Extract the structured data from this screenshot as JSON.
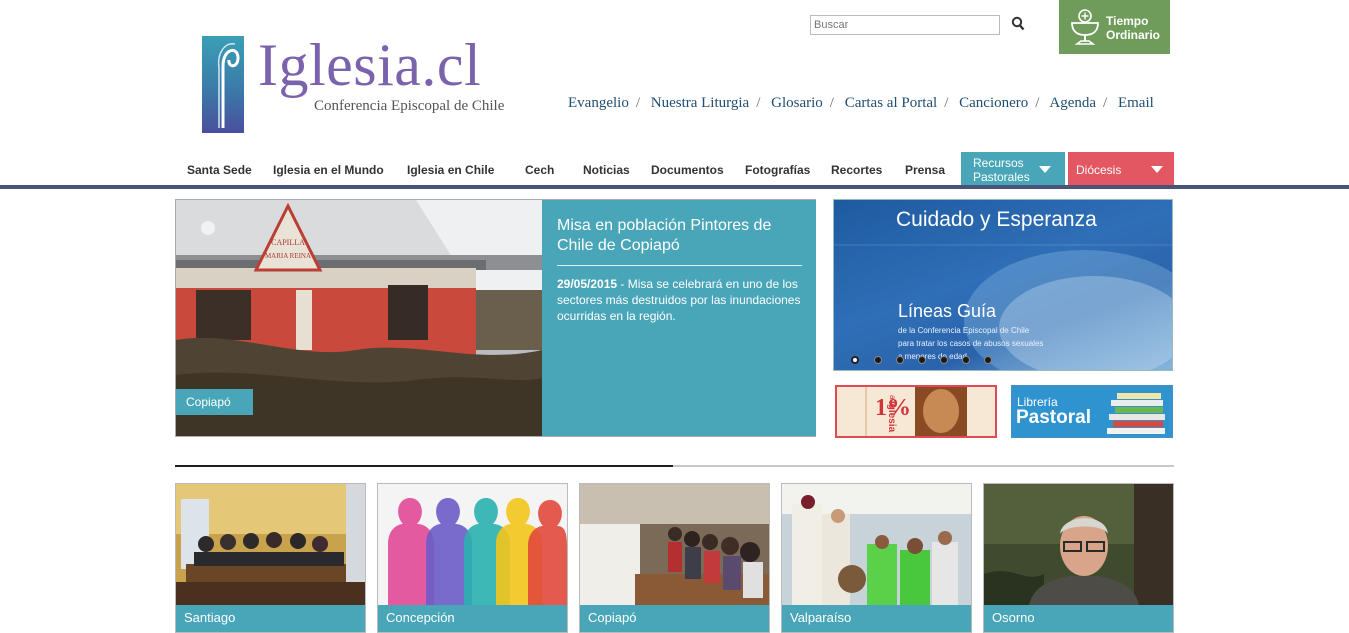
{
  "logo": {
    "word": "Iglesia.cl",
    "sub": "Conferencia Episcopal de Chile"
  },
  "search": {
    "placeholder": "Buscar"
  },
  "tiempo": {
    "line1": "Tiempo",
    "line2": "Ordinario"
  },
  "toplinks": [
    "Evangelio",
    "Nuestra Liturgia",
    "Glosario",
    "Cartas al Portal",
    "Cancionero",
    "Agenda",
    "Email"
  ],
  "nav": {
    "items": [
      "Santa Sede",
      "Iglesia en el Mundo",
      "Iglesia en Chile",
      "Cech",
      "Noticias",
      "Documentos",
      "Fotografías",
      "Recortes",
      "Prensa"
    ],
    "recursos": {
      "line1": "Recursos",
      "line2": "Pastorales",
      "color": "#49a6b8"
    },
    "diocesis": {
      "label": "Diócesis",
      "color": "#e25762"
    }
  },
  "slider": {
    "title": "Misa en población Pintores de Chile de Copiapó",
    "date": "29/05/2015",
    "text": " - Misa se celebrará en uno de los sectores más destruidos por las inundaciones ocurridas en la región.",
    "tag": "Copiapó",
    "sign_line1": "CAPILLA",
    "sign_line2": "MARIA REINA"
  },
  "banner": {
    "heading": "Cuidado y Esperanza",
    "line1": "Líneas Guía",
    "line2": "de la Conferencia Episcopal de Chile",
    "line3": "para tratar los casos de abusos sexuales",
    "line4": "a menores de edad"
  },
  "ads": {
    "one": {
      "pct": "1%",
      "word1": "a la",
      "word2": "Iglesia"
    },
    "two": {
      "word1": "Librería",
      "word2": "Pastoral"
    }
  },
  "thumbs": [
    "Santiago",
    "Concepción",
    "Copiapó",
    "Valparaíso",
    "Osorno"
  ],
  "colors": {
    "teal": "#49a6b8",
    "navy_bar": "#4a5478",
    "green": "#6f9c5a",
    "red": "#e25762",
    "purple": "#7a62ad"
  }
}
